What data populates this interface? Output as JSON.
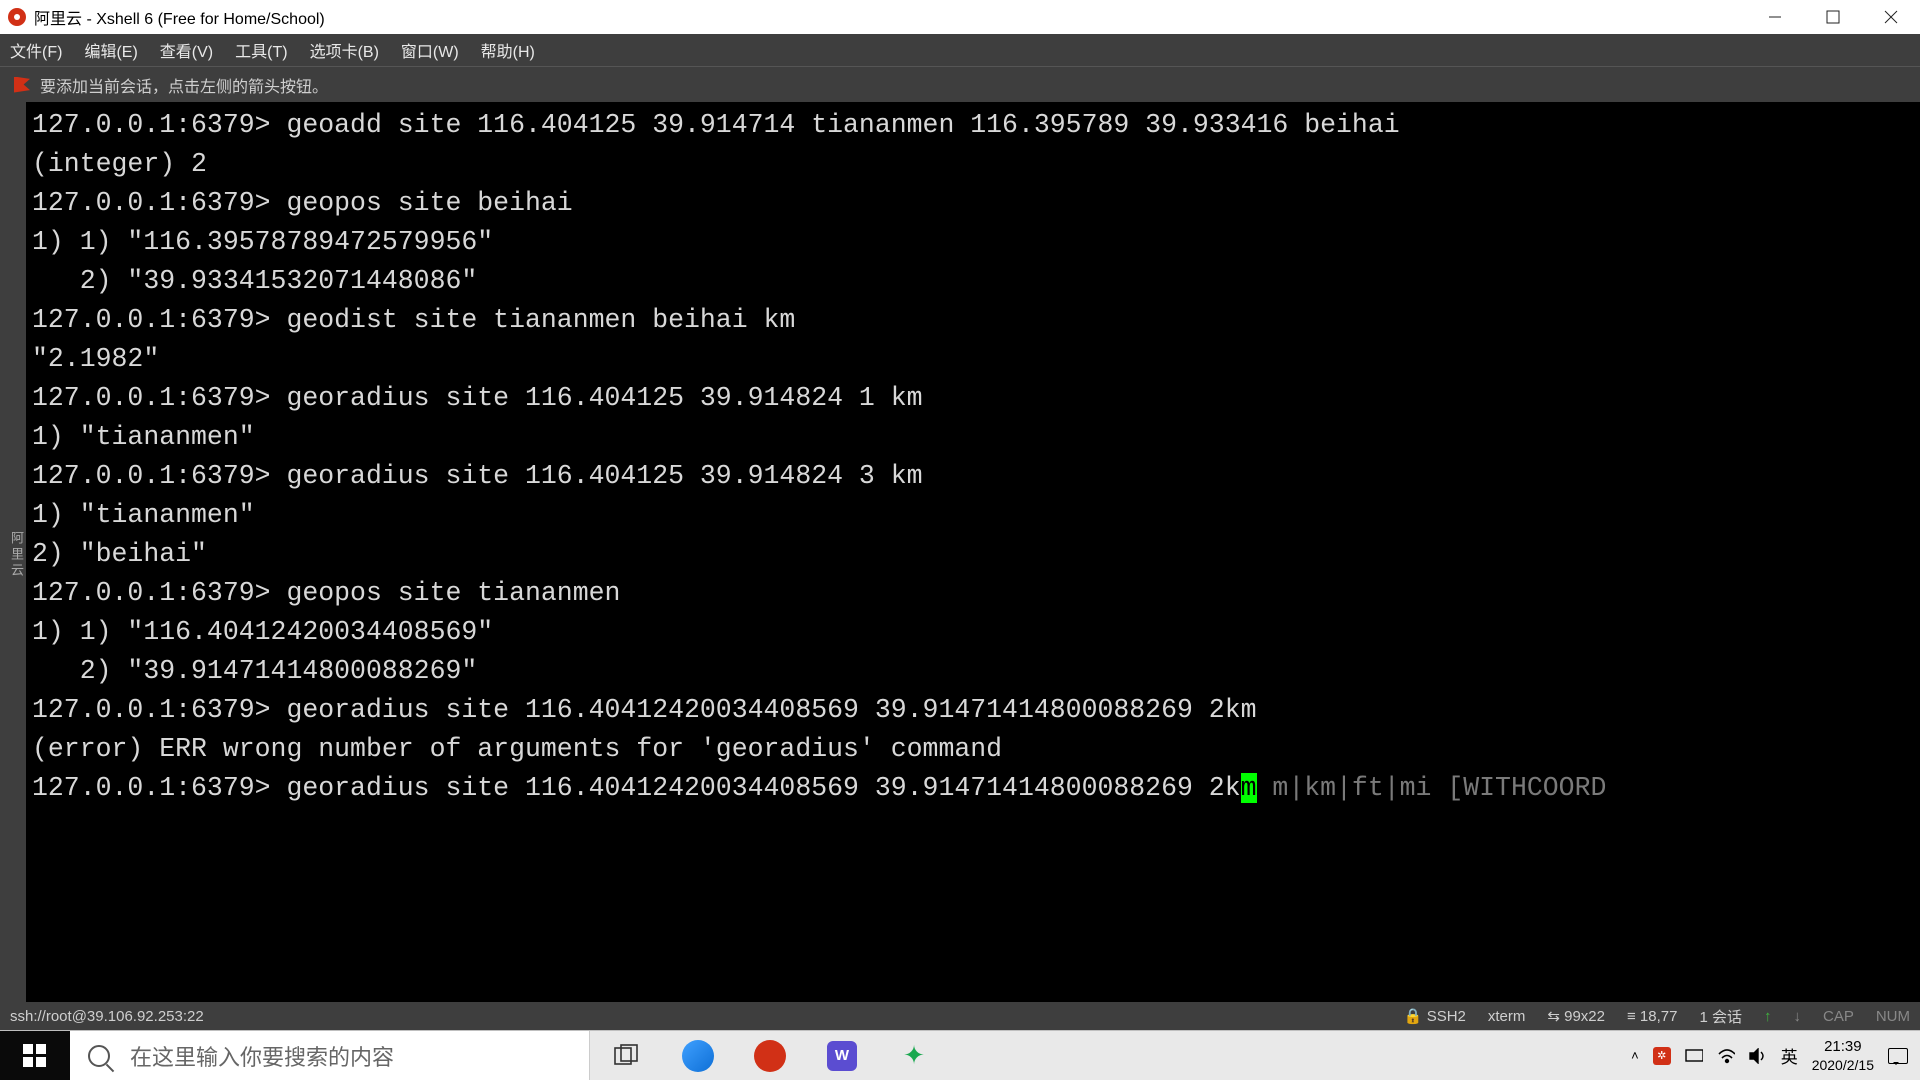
{
  "title": "阿里云 - Xshell 6 (Free for Home/School)",
  "menu": [
    "文件(F)",
    "编辑(E)",
    "查看(V)",
    "工具(T)",
    "选项卡(B)",
    "窗口(W)",
    "帮助(H)"
  ],
  "tipbar": "要添加当前会话，点击左侧的箭头按钮。",
  "vtabs": "阿里云",
  "terminal": {
    "prompt": "127.0.0.1:6379> ",
    "lines": [
      "127.0.0.1:6379> geoadd site 116.404125 39.914714 tiananmen 116.395789 39.933416 beihai",
      "(integer) 2",
      "127.0.0.1:6379> geopos site beihai",
      "1) 1) \"116.39578789472579956\"",
      "   2) \"39.93341532071448086\"",
      "127.0.0.1:6379> geodist site tiananmen beihai km",
      "\"2.1982\"",
      "127.0.0.1:6379> georadius site 116.404125 39.914824 1 km",
      "1) \"tiananmen\"",
      "127.0.0.1:6379> georadius site 116.404125 39.914824 3 km",
      "1) \"tiananmen\"",
      "2) \"beihai\"",
      "127.0.0.1:6379> geopos site tiananmen",
      "1) 1) \"116.40412420034408569\"",
      "   2) \"39.91471414800088269\"",
      "127.0.0.1:6379> georadius site 116.40412420034408569 39.91471414800088269 2km",
      "(error) ERR wrong number of arguments for 'georadius' command"
    ],
    "current_input_pre": "127.0.0.1:6379> georadius site 116.40412420034408569 39.91471414800088269 2k",
    "current_cursor": "m",
    "current_hint": " m|km|ft|mi [WITHCOORD"
  },
  "status": {
    "left": "ssh://root@39.106.92.253:22",
    "ssh": "SSH2",
    "term": "xterm",
    "size": "99x22",
    "pos": "18,77",
    "sessions": "1 会话",
    "caps": "CAP",
    "num": "NUM"
  },
  "taskbar": {
    "search_placeholder": "在这里输入你要搜索的内容",
    "ime": "英",
    "time": "21:39",
    "date": "2020/2/15"
  }
}
